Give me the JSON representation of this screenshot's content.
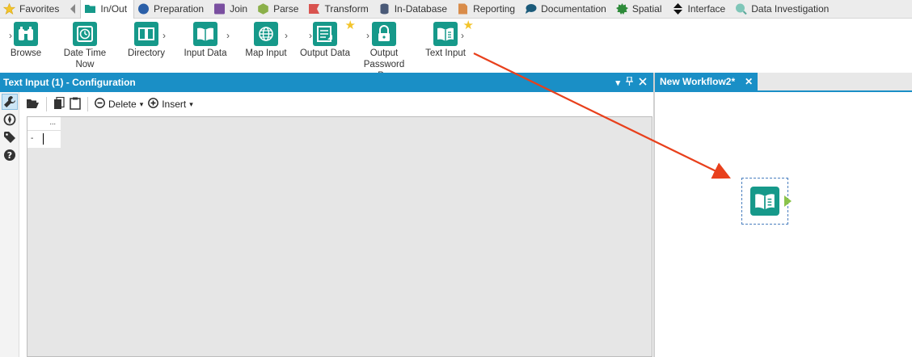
{
  "tabs": [
    {
      "label": "Favorites",
      "icon": "star-icon",
      "color": "#f3c42b",
      "active": false
    },
    {
      "label": "In/Out",
      "icon": "folder-icon",
      "color": "#16998a",
      "active": true
    },
    {
      "label": "Preparation",
      "icon": "circle-icon",
      "color": "#2a5fa8",
      "active": false
    },
    {
      "label": "Join",
      "icon": "square-icon",
      "color": "#7a4fa0",
      "active": false
    },
    {
      "label": "Parse",
      "icon": "hexagon-icon",
      "color": "#8bb04a",
      "active": false
    },
    {
      "label": "Transform",
      "icon": "ribbon-icon",
      "color": "#d9534f",
      "active": false
    },
    {
      "label": "In-Database",
      "icon": "database-icon",
      "color": "#4a5a78",
      "active": false
    },
    {
      "label": "Reporting",
      "icon": "document-icon",
      "color": "#d98c4a",
      "active": false
    },
    {
      "label": "Documentation",
      "icon": "speech-bubble-icon",
      "color": "#1b5a7a",
      "active": false
    },
    {
      "label": "Spatial",
      "icon": "gear-icon",
      "color": "#2e8b3a",
      "active": false
    },
    {
      "label": "Interface",
      "icon": "up-down-arrows-icon",
      "color": "#111111",
      "active": false
    },
    {
      "label": "Data Investigation",
      "icon": "magnifier-icon",
      "color": "#7fc6b8",
      "active": false
    }
  ],
  "tools": [
    {
      "label": "Browse",
      "icon": "binoculars-icon"
    },
    {
      "label": "Date Time Now",
      "icon": "clock-icon"
    },
    {
      "label": "Directory",
      "icon": "book-icon"
    },
    {
      "label": "Input Data",
      "icon": "book-open-icon"
    },
    {
      "label": "Map Input",
      "icon": "globe-icon"
    },
    {
      "label": "Output Data",
      "icon": "document-output-icon",
      "favorite": true
    },
    {
      "label": "Output Password P...",
      "icon": "lock-icon"
    },
    {
      "label": "Text Input",
      "icon": "text-book-icon",
      "favorite": true
    }
  ],
  "config": {
    "title": "Text Input (1) - Configuration",
    "toolbar": {
      "delete_label": "Delete",
      "insert_label": "Insert"
    },
    "grid": {
      "header_text": "...",
      "row_marker": "-"
    }
  },
  "workflow": {
    "tab_title": "New Workflow2*",
    "close": "✕"
  },
  "colors": {
    "accent": "#1a8fc6",
    "tool_teal": "#16998a",
    "arrow": "#e8401c",
    "anchor": "#8ac34a"
  }
}
